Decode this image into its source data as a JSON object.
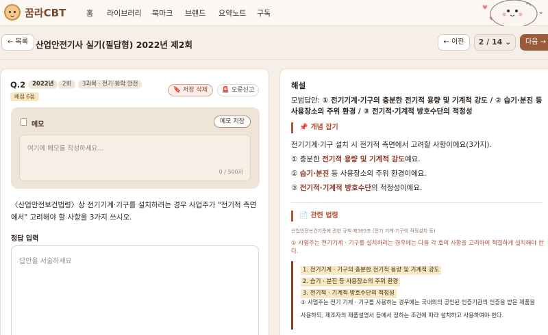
{
  "nav": {
    "logo": "꿈라CBT",
    "items": [
      "홈",
      "라이브러리",
      "북마크",
      "브랜드",
      "요약노트",
      "구독"
    ]
  },
  "subhead": {
    "list_button": "← 목록",
    "title": "산업안전기사 실기(필답형) 2022년 제2회",
    "prev_button": "← 이전",
    "pager": "2 / 14 ⌄",
    "next_button": "다음 →"
  },
  "question": {
    "number": "Q.2",
    "year": "2022년",
    "round": "2회",
    "subject": "3과목 · 전기·화학 안전",
    "score": "배점 6점",
    "save_delete": "🔖 저장 삭제",
    "report": "🚨 오류신고",
    "memo_label": "메모",
    "memo_save": "메모 저장",
    "memo_placeholder": "여기에 메모를 작성하세요...",
    "memo_count": "0 / 500자",
    "text": "〈산업안전보건법령〉상 전기기계·기구를 설치하려는 경우 사업주가 \"전기적 측면에서\" 고려해야 할 사항을 3가지 쓰시오.",
    "answer_label": "정답 입력",
    "answer_placeholder": "답안을 서술하세요"
  },
  "explanation": {
    "title": "해설",
    "model_prefix": "모범답안: ",
    "model_answer": "① 전기기계·기구의 충분한 전기적 용량 및 기계적 강도 / ② 습기·분진 등 사용장소의 주위 환경 / ③ 전기적·기계적 방호수단의 적정성",
    "concept_head": "개념 잡기",
    "concept_intro": "전기기계·기구 설치 시 전기적 측면에서 고려할 사항이에요(3가지).",
    "points": [
      {
        "num": "①",
        "pre": "충분한 ",
        "hl": "전기적 용량 및 기계적 강도",
        "post": "예요."
      },
      {
        "num": "②",
        "pre": "",
        "hl": "습기·분진",
        "post": " 등 사용장소의 주위 환경이에요."
      },
      {
        "num": "③",
        "pre": "",
        "hl": "전기적·기계적 방호수단",
        "post": "의 적정성이에요."
      }
    ],
    "law_head": "관련 법령",
    "law_sub": "산업안전보건기준에 관한 규칙 제303조 (전기 기계·기구의 적정설치 등)",
    "law_red": "① 사업주는 전기기계 · 기구를 설치하려는 경우에는 다음 각 호의 사항을 고려하여 적절하게 설치해야 한다.",
    "law_items": [
      "1. 전기기계 · 기구의 충분한 전기적 용량 및 기계적 강도",
      "2. 습기 · 분진 등 사용장소의 주위 환경",
      "3. 전기적 · 기계적 방호수단의 적정성"
    ],
    "law_note": "② 사업주는 전기 기계 · 기구를 사용하는 경우에는 국내외의 공인된 인증기관의 인증을 받은 제품을 사용하되, 제조자의 제품설명서 등에서 정하는 조건에 따라 설치하고 사용하여야 한다."
  }
}
